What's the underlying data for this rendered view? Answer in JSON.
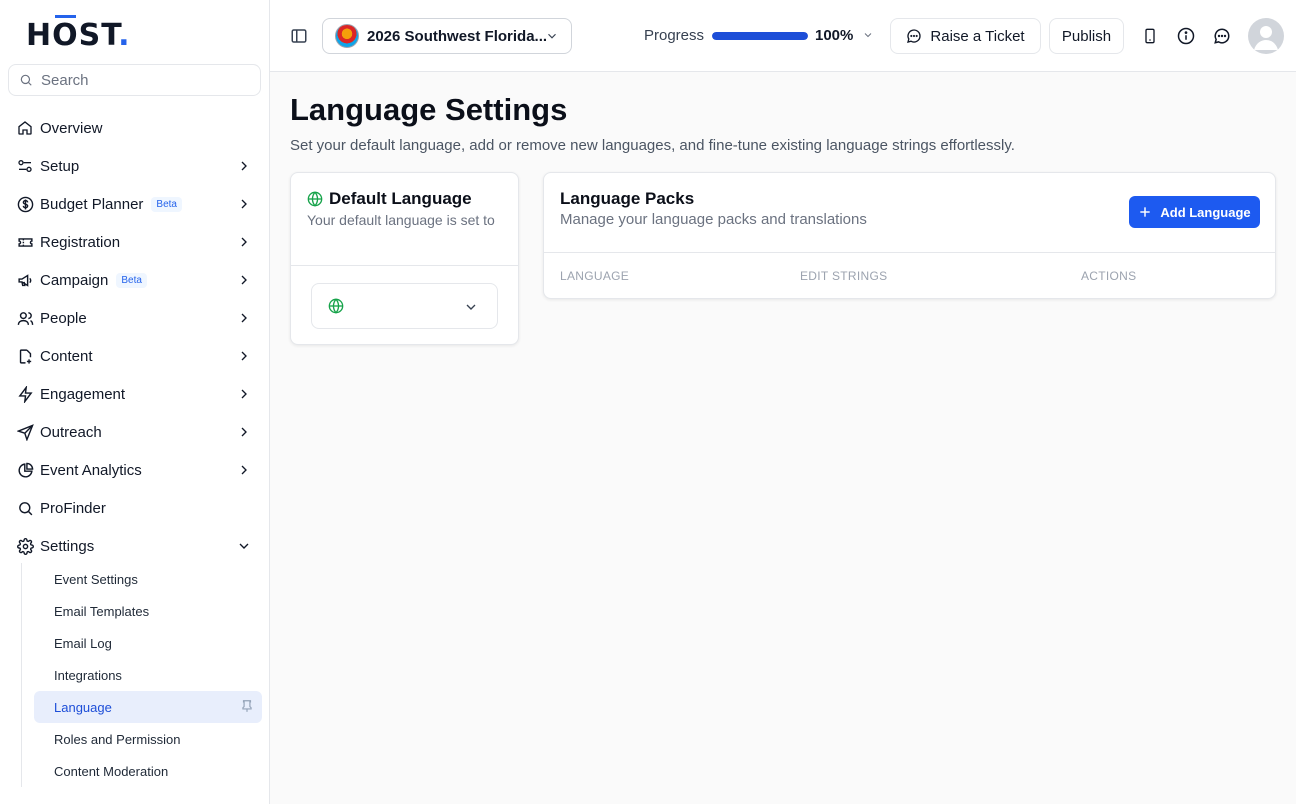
{
  "brand": {
    "logo_text_pre": "H",
    "logo_text_o": "O",
    "logo_text_post": "ST",
    "logo_dot": "."
  },
  "search": {
    "placeholder": "Search"
  },
  "sidebar": {
    "items": [
      {
        "label": "Overview",
        "icon": "home-icon"
      },
      {
        "label": "Setup",
        "icon": "sliders-icon"
      },
      {
        "label": "Budget Planner",
        "icon": "dollar-icon",
        "badge": "Beta"
      },
      {
        "label": "Registration",
        "icon": "ticket-icon"
      },
      {
        "label": "Campaign",
        "icon": "megaphone-icon",
        "badge": "Beta"
      },
      {
        "label": "People",
        "icon": "users-icon"
      },
      {
        "label": "Content",
        "icon": "file-icon"
      },
      {
        "label": "Engagement",
        "icon": "bolt-icon"
      },
      {
        "label": "Outreach",
        "icon": "send-icon"
      },
      {
        "label": "Event Analytics",
        "icon": "pie-chart-icon"
      },
      {
        "label": "ProFinder",
        "icon": "search-icon"
      },
      {
        "label": "Settings",
        "icon": "gear-icon"
      }
    ],
    "settings_sub": [
      "Event Settings",
      "Email Templates",
      "Email Log",
      "Integrations",
      "Language",
      "Roles and Permission",
      "Content Moderation"
    ],
    "active_sub": "Language"
  },
  "topbar": {
    "event_name": "2026 Southwest Florida...",
    "progress_label": "Progress",
    "progress_value": "100%",
    "progress_fraction": 1.0,
    "raise_ticket": "Raise a Ticket",
    "publish": "Publish"
  },
  "page": {
    "title": "Language Settings",
    "subtitle": "Set your default language, add or remove new languages, and fine-tune existing language strings effortlessly."
  },
  "default_language": {
    "title": "Default Language",
    "description": "Your default language is set to"
  },
  "language_packs": {
    "title": "Language Packs",
    "subtitle": "Manage your language packs and translations",
    "add_button": "Add Language",
    "columns": [
      "LANGUAGE",
      "EDIT STRINGS",
      "ACTIONS"
    ]
  },
  "colors": {
    "accent": "#1d5af0",
    "globe": "#16a34a"
  }
}
